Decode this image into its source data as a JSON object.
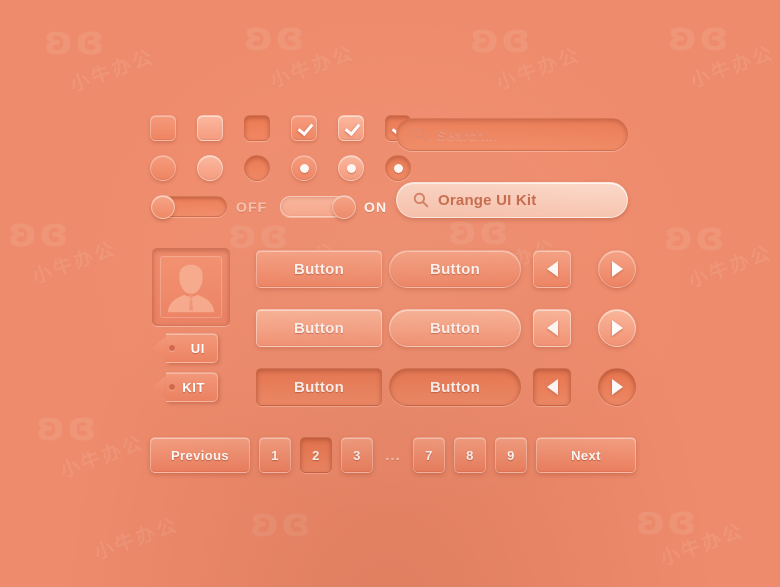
{
  "meta": {
    "background_color": "#ee8b6c",
    "accent_color": "#f59a7c",
    "text_color": "#ffffff",
    "pressed_color": "#e8744d",
    "watermark_big": "ʚɞ",
    "watermark_small": "小牛办公"
  },
  "controls": {
    "checkboxes": [
      {
        "state": "normal",
        "checked": false
      },
      {
        "state": "hover",
        "checked": false
      },
      {
        "state": "pressed",
        "checked": false
      },
      {
        "state": "normal",
        "checked": true
      },
      {
        "state": "hover",
        "checked": true
      },
      {
        "state": "pressed",
        "checked": true
      }
    ],
    "radios": [
      {
        "state": "normal",
        "selected": false
      },
      {
        "state": "hover",
        "selected": false
      },
      {
        "state": "pressed",
        "selected": false
      },
      {
        "state": "normal",
        "selected": true
      },
      {
        "state": "hover",
        "selected": true
      },
      {
        "state": "pressed",
        "selected": true
      }
    ],
    "toggles": [
      {
        "label": "OFF",
        "on": false
      },
      {
        "label": "ON",
        "on": true
      }
    ]
  },
  "search": {
    "inactive": {
      "placeholder": "Search...",
      "value": "",
      "icon": "search-icon"
    },
    "active": {
      "placeholder": "Search...",
      "value": "Orange UI Kit",
      "icon": "search-icon"
    }
  },
  "avatar": {
    "icon": "user-avatar-icon",
    "alt": "user avatar placeholder"
  },
  "tags": [
    {
      "label": "UI"
    },
    {
      "label": "KIT"
    }
  ],
  "buttons": {
    "rect": [
      {
        "label": "Button",
        "state": "normal"
      },
      {
        "label": "Button",
        "state": "hover"
      },
      {
        "label": "Button",
        "state": "pressed"
      }
    ],
    "pill": [
      {
        "label": "Button",
        "state": "normal"
      },
      {
        "label": "Button",
        "state": "hover"
      },
      {
        "label": "Button",
        "state": "pressed"
      }
    ],
    "square_arrows": [
      {
        "icon": "arrow-left-icon",
        "state": "normal"
      },
      {
        "icon": "arrow-left-icon",
        "state": "hover"
      },
      {
        "icon": "arrow-left-icon",
        "state": "pressed"
      }
    ],
    "circle_arrows": [
      {
        "icon": "arrow-right-icon",
        "state": "normal"
      },
      {
        "icon": "arrow-right-icon",
        "state": "hover"
      },
      {
        "icon": "arrow-right-icon",
        "state": "pressed"
      }
    ]
  },
  "pagination": {
    "previous_label": "Previous",
    "next_label": "Next",
    "ellipsis": "...",
    "current_page": "2",
    "pages": [
      "1",
      "2",
      "3",
      "...",
      "7",
      "8",
      "9"
    ]
  }
}
